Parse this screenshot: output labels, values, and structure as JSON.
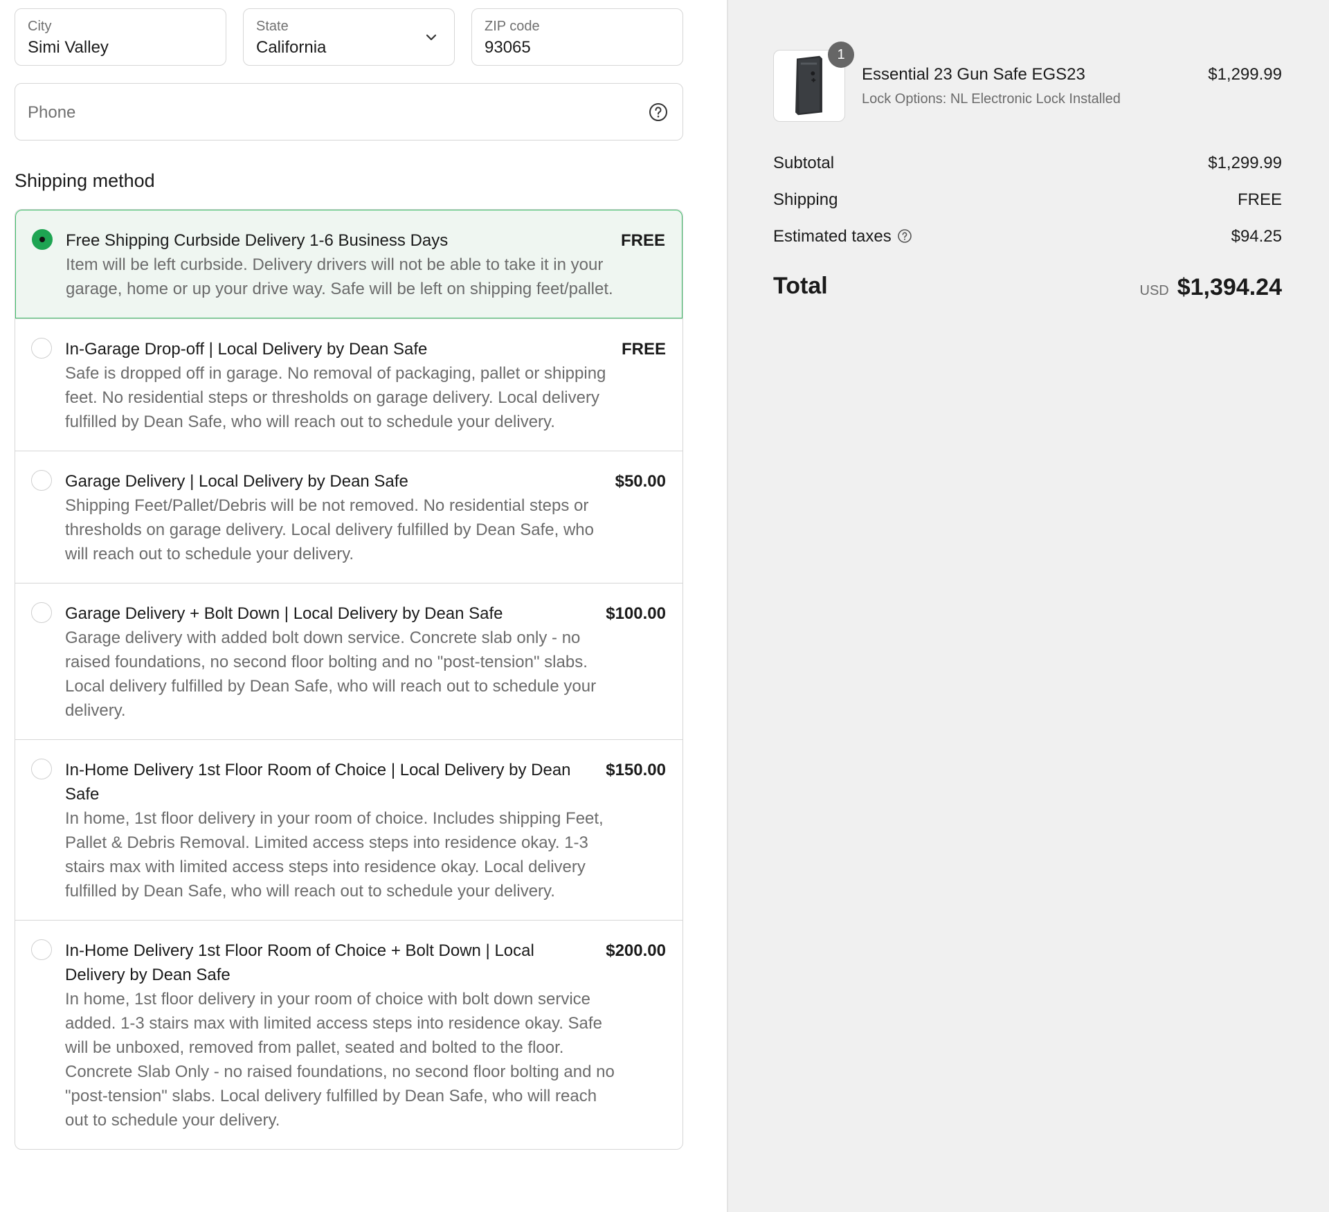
{
  "address": {
    "city": {
      "label": "City",
      "value": "Simi Valley"
    },
    "state": {
      "label": "State",
      "value": "California"
    },
    "zip": {
      "label": "ZIP code",
      "value": "93065"
    },
    "phone": {
      "placeholder": "Phone"
    }
  },
  "shipping": {
    "title": "Shipping method",
    "options": [
      {
        "title": "Free Shipping Curbside Delivery 1-6 Business Days",
        "price": "FREE",
        "desc": "Item will be left curbside. Delivery drivers will not be able to take it in your garage, home or up your drive way. Safe will be left on shipping feet/pallet.",
        "selected": true
      },
      {
        "title": "In-Garage Drop-off | Local Delivery by Dean Safe",
        "price": "FREE",
        "desc": "Safe is dropped off in garage. No removal of packaging, pallet or shipping feet. No residential steps or thresholds on garage delivery. Local delivery fulfilled by Dean Safe, who will reach out to schedule your delivery.",
        "selected": false
      },
      {
        "title": "Garage Delivery | Local Delivery by Dean Safe",
        "price": "$50.00",
        "desc": "Shipping Feet/Pallet/Debris will be not removed. No residential steps or thresholds on garage delivery. Local delivery fulfilled by Dean Safe, who will reach out to schedule your delivery.",
        "selected": false
      },
      {
        "title": "Garage Delivery + Bolt Down | Local Delivery by Dean Safe",
        "price": "$100.00",
        "desc": "Garage delivery with added bolt down service. Concrete slab only - no raised foundations, no second floor bolting and no \"post-tension\" slabs. Local delivery fulfilled by Dean Safe, who will reach out to schedule your delivery.",
        "selected": false
      },
      {
        "title": "In-Home Delivery 1st Floor Room of Choice | Local Delivery by Dean Safe",
        "price": "$150.00",
        "desc": "In home, 1st floor delivery in your room of choice. Includes shipping Feet, Pallet & Debris Removal. Limited access steps into residence okay. 1-3 stairs max with limited access steps into residence okay. Local delivery fulfilled by Dean Safe, who will reach out to schedule your delivery.",
        "selected": false
      },
      {
        "title": "In-Home Delivery 1st Floor Room of Choice + Bolt Down | Local Delivery by Dean Safe",
        "price": "$200.00",
        "desc": "In home, 1st floor delivery in your room of choice with bolt down service added. 1-3 stairs max with limited access steps into residence okay. Safe will be unboxed, removed from pallet, seated and bolted to the floor. Concrete Slab Only - no raised foundations, no second floor bolting and no \"post-tension\" slabs. Local delivery fulfilled by Dean Safe, who will reach out to schedule your delivery.",
        "selected": false
      }
    ]
  },
  "summary": {
    "product": {
      "quantity": "1",
      "name": "Essential 23 Gun Safe EGS23",
      "variant": "Lock Options: NL Electronic Lock Installed",
      "price": "$1,299.99"
    },
    "subtotal": {
      "label": "Subtotal",
      "value": "$1,299.99"
    },
    "shipping": {
      "label": "Shipping",
      "value": "FREE"
    },
    "taxes": {
      "label": "Estimated taxes",
      "value": "$94.25"
    },
    "total": {
      "label": "Total",
      "currency": "USD",
      "value": "$1,394.24"
    }
  },
  "colors": {
    "accent": "#1ea452",
    "selected_bg": "#eff6f1",
    "selected_border": "#3fbd6a",
    "summary_bg": "#f0f0f0"
  },
  "icons": {
    "state_dropdown": "chevron-down-icon",
    "phone_help": "question-circle-icon",
    "taxes_help": "question-circle-icon",
    "product_image": "gun-safe-image"
  }
}
